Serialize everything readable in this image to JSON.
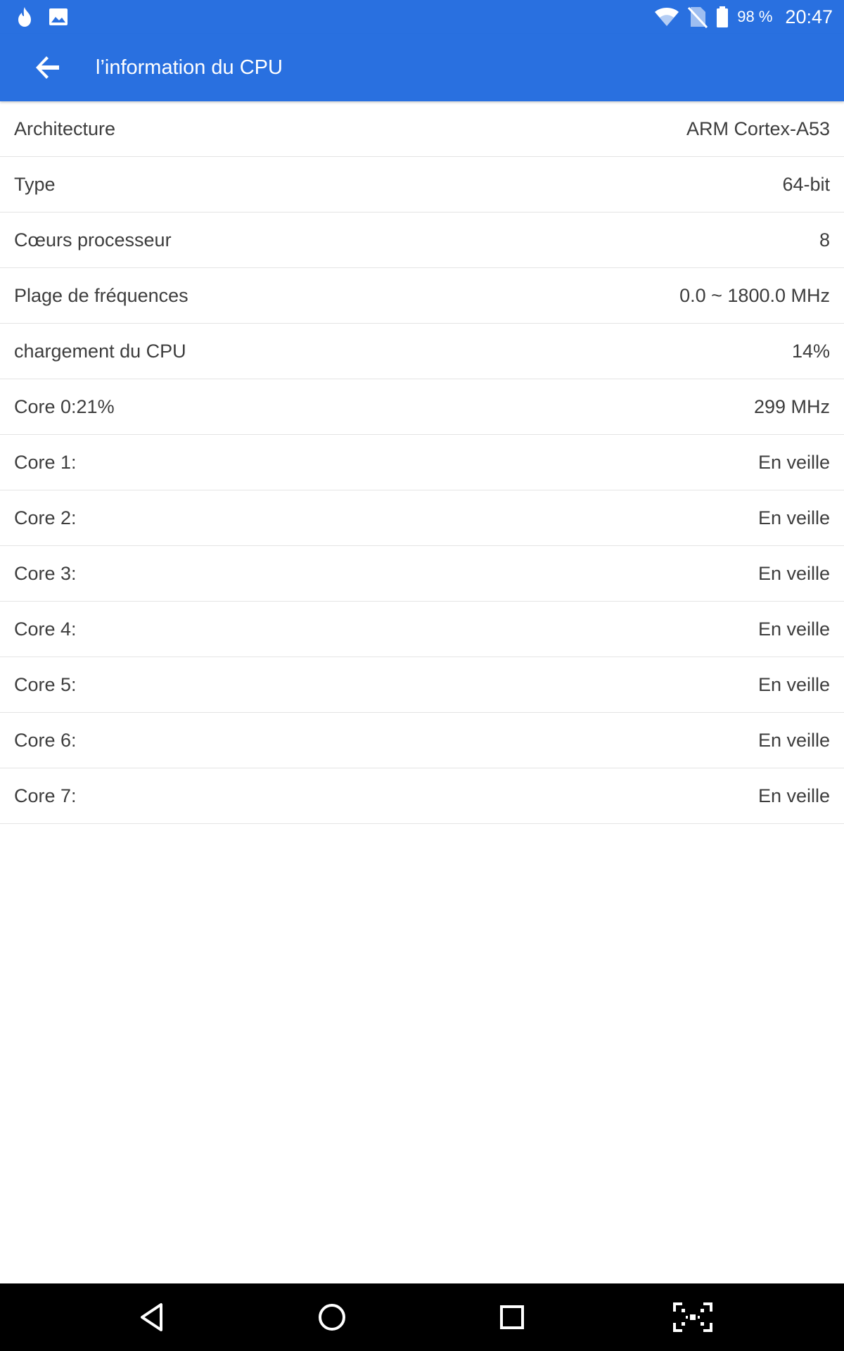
{
  "status_bar": {
    "left_icons": [
      "flame-icon",
      "image-icon"
    ],
    "right_icons": [
      "wifi-icon",
      "no-sim-icon",
      "battery-icon"
    ],
    "battery": "98 %",
    "time": "20:47"
  },
  "app_bar": {
    "title": "l’information du CPU",
    "back_icon": "arrow-back-icon",
    "color": "#2970e0"
  },
  "rows": [
    {
      "label": "Architecture",
      "value": "ARM Cortex-A53"
    },
    {
      "label": "Type",
      "value": "64-bit"
    },
    {
      "label": "Cœurs processeur",
      "value": "8"
    },
    {
      "label": "Plage de fréquences",
      "value": "0.0 ~ 1800.0 MHz"
    },
    {
      "label": "chargement du CPU",
      "value": "14%"
    },
    {
      "label": "Core 0:21%",
      "value": "299 MHz"
    },
    {
      "label": "Core 1:",
      "value": "En veille"
    },
    {
      "label": "Core 2:",
      "value": "En veille"
    },
    {
      "label": "Core 3:",
      "value": "En veille"
    },
    {
      "label": "Core 4:",
      "value": "En veille"
    },
    {
      "label": "Core 5:",
      "value": "En veille"
    },
    {
      "label": "Core 6:",
      "value": "En veille"
    },
    {
      "label": "Core 7:",
      "value": "En veille"
    }
  ],
  "nav_bar": {
    "buttons": [
      "back-triangle-icon",
      "home-circle-icon",
      "recents-square-icon",
      "screenshot-icon"
    ]
  }
}
